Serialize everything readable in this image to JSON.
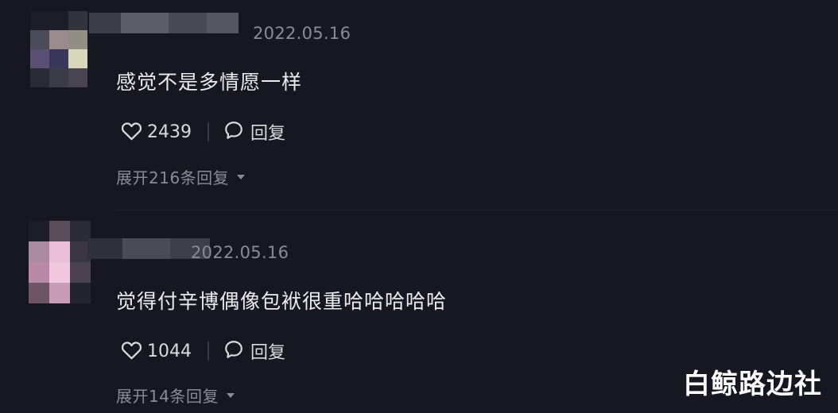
{
  "comments": [
    {
      "date": "2022.05.16",
      "text": "感觉不是多情愿一样",
      "likes": "2439",
      "reply_label": "回复",
      "expand_label": "展开216条回复"
    },
    {
      "date": "2022.05.16",
      "text": "觉得付辛博偶像包袱很重哈哈哈哈哈",
      "likes": "1044",
      "reply_label": "回复",
      "expand_label": "展开14条回复"
    }
  ],
  "watermark": "白鲸路边社",
  "icons": {
    "like": "heart-outline-icon",
    "reply": "speech-bubble-icon",
    "expand": "triangle-down-icon"
  },
  "colors": {
    "background": "#161721",
    "text": "#ececf0",
    "muted": "#8a8b94"
  }
}
